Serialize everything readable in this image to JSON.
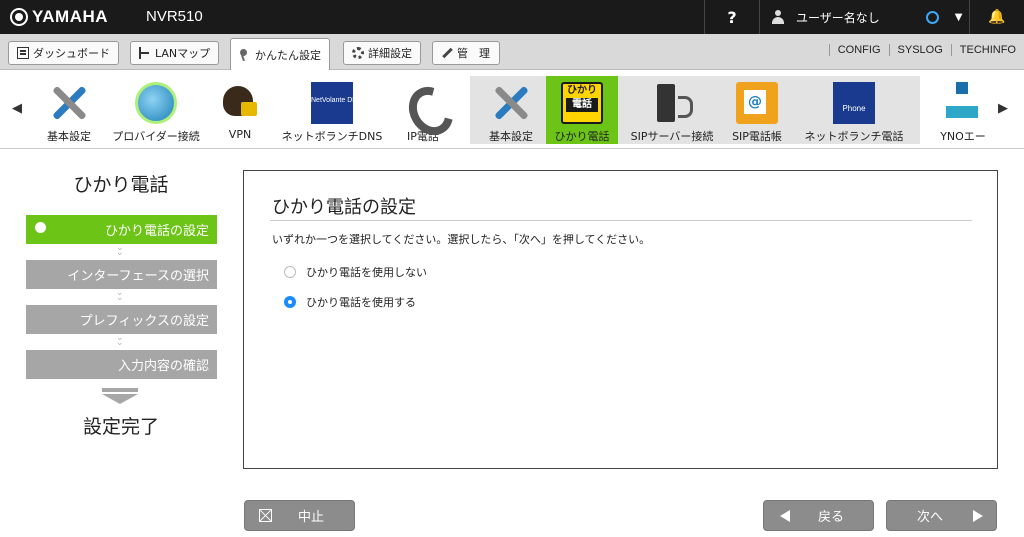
{
  "header": {
    "brand": "YAMAHA",
    "model": "NVR510",
    "help_label": "?",
    "user_name": "ユーザー名なし",
    "status_ring_color": "#3fa7f5"
  },
  "menu": {
    "dashboard": "ダッシュボード",
    "lan_map": "LANマップ",
    "easy_setup": "かんたん設定",
    "advanced": "詳細設定",
    "admin": "管　理",
    "links": [
      "CONFIG",
      "SYSLOG",
      "TECHINFO"
    ]
  },
  "icon_strip": {
    "left_arrow": "◀",
    "right_arrow": "▶",
    "items": [
      {
        "label": "基本設定",
        "icon": "tools-icon"
      },
      {
        "label": "プロバイダー接続",
        "icon": "globe-icon"
      },
      {
        "label": "VPN",
        "icon": "vpn-lock-icon"
      },
      {
        "label": "ネットボランチDNS",
        "icon": "ddns-icon",
        "icon_text": "NetVolante DDNS Service"
      },
      {
        "label": "IP電話",
        "icon": "phone-icon"
      },
      {
        "label": "基本設定",
        "icon": "tools-icon"
      },
      {
        "label": "ひかり電話",
        "icon": "hikari-phone-icon",
        "icon_text": [
          "ひかり",
          "電話"
        ],
        "selected": true
      },
      {
        "label": "SIPサーバー接続",
        "icon": "sip-server-icon"
      },
      {
        "label": "SIP電話帳",
        "icon": "address-book-icon"
      },
      {
        "label": "ネットボランチ電話",
        "icon": "netvolante-phone-icon",
        "icon_text": "Phone"
      },
      {
        "label": "YNOエー",
        "icon": "yno-icon"
      }
    ]
  },
  "wizard": {
    "title": "ひかり電話",
    "steps": [
      "ひかり電話の設定",
      "インターフェースの選択",
      "プレフィックスの設定",
      "入力内容の確認"
    ],
    "current_step": 0,
    "done_label": "設定完了",
    "active_color": "#6cc417"
  },
  "panel": {
    "title": "ひかり電話の設定",
    "description": "いずれか一つを選択してください。選択したら、「次へ」を押してください。",
    "options": [
      {
        "label": "ひかり電話を使用しない",
        "checked": false
      },
      {
        "label": "ひかり電話を使用する",
        "checked": true
      }
    ]
  },
  "buttons": {
    "cancel": "中止",
    "back": "戻る",
    "next": "次へ"
  }
}
